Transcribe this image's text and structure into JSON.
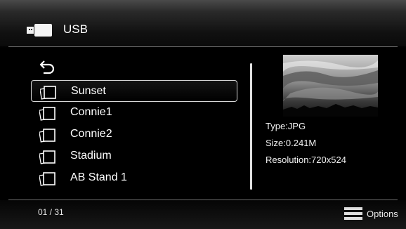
{
  "header": {
    "title": "USB",
    "icon": "usb-drive-icon"
  },
  "list": {
    "back_icon": "back-arrow-icon",
    "item_icon": "photo-folder-icon",
    "selected_index": 0,
    "items": [
      {
        "label": "Sunset"
      },
      {
        "label": "Connie1"
      },
      {
        "label": "Connie2"
      },
      {
        "label": "Stadium"
      },
      {
        "label": "AB Stand 1"
      }
    ]
  },
  "preview": {
    "thumbnail": "sunset-photo-thumbnail",
    "type": "Type:JPG",
    "size": "Size:0.241M",
    "resolution": "Resolution:720x524"
  },
  "footer": {
    "page_count": "01 / 31",
    "options_label": "Options",
    "options_icon": "menu-icon"
  },
  "colors": {
    "background": "#000000",
    "text": "#ffffff",
    "rule": "#6a6a6a",
    "selection_border": "#d8d8d8"
  }
}
